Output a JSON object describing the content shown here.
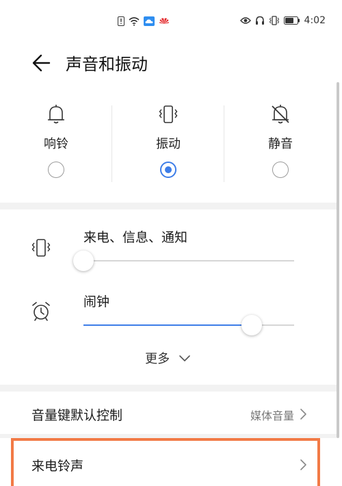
{
  "status_bar": {
    "time": "4:02",
    "left_icons": [
      "sim-alert-icon",
      "wifi-icon",
      "cloud-icon",
      "huawei-logo-icon"
    ],
    "right_icons": [
      "eye-icon",
      "headset-icon",
      "vibrate-icon",
      "battery-icon"
    ]
  },
  "header": {
    "title": "声音和振动"
  },
  "modes": [
    {
      "label": "响铃",
      "icon": "bell-icon",
      "selected": false
    },
    {
      "label": "振动",
      "icon": "vibrate-icon",
      "selected": true
    },
    {
      "label": "静音",
      "icon": "bell-off-icon",
      "selected": false
    }
  ],
  "volumes": [
    {
      "label": "来电、信息、通知",
      "icon": "vibrate-icon",
      "level": 0
    },
    {
      "label": "闹钟",
      "icon": "alarm-clock-icon",
      "level": 0.8
    }
  ],
  "more": {
    "label": "更多"
  },
  "list": [
    {
      "label": "音量键默认控制",
      "value": "媒体音量"
    },
    {
      "label": "来电铃声",
      "value": ""
    }
  ],
  "colors": {
    "accent": "#3d7de8",
    "highlight": "#f27a46"
  }
}
